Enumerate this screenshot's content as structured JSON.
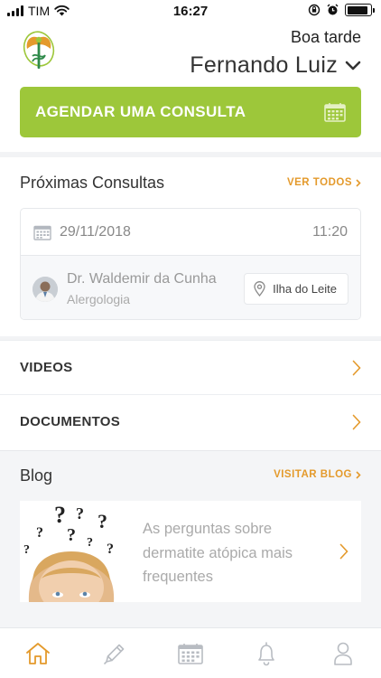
{
  "status_bar": {
    "carrier": "TIM",
    "time": "16:27",
    "battery_level": 0.9
  },
  "header": {
    "greeting": "Boa tarde",
    "user_name": "Fernando Luiz",
    "logo_icon": "medical-logo-icon"
  },
  "cta": {
    "label": "AGENDAR UMA CONSULTA",
    "icon": "calendar-icon"
  },
  "appointments": {
    "title": "Próximas Consultas",
    "link_label": "VER TODOS",
    "items": [
      {
        "date": "29/11/2018",
        "time": "11:20",
        "doctor": "Dr. Waldemir da Cunha",
        "specialty": "Alergologia",
        "location": "Ilha do Leite"
      }
    ]
  },
  "rows": [
    {
      "label": "VIDEOS"
    },
    {
      "label": "DOCUMENTOS"
    }
  ],
  "blog": {
    "title": "Blog",
    "link_label": "VISITAR BLOG",
    "post": {
      "title": "As perguntas sobre dermatite atópica mais frequentes"
    }
  },
  "tabs": [
    {
      "icon": "home-icon",
      "active": true
    },
    {
      "icon": "pencil-icon",
      "active": false
    },
    {
      "icon": "calendar-icon",
      "active": false
    },
    {
      "icon": "bell-icon",
      "active": false
    },
    {
      "icon": "user-icon",
      "active": false
    }
  ],
  "colors": {
    "accent_green": "#9dc73a",
    "accent_orange": "#e49a2c",
    "tab_active": "#e49a2c",
    "tab_inactive": "#b8bcc2"
  }
}
